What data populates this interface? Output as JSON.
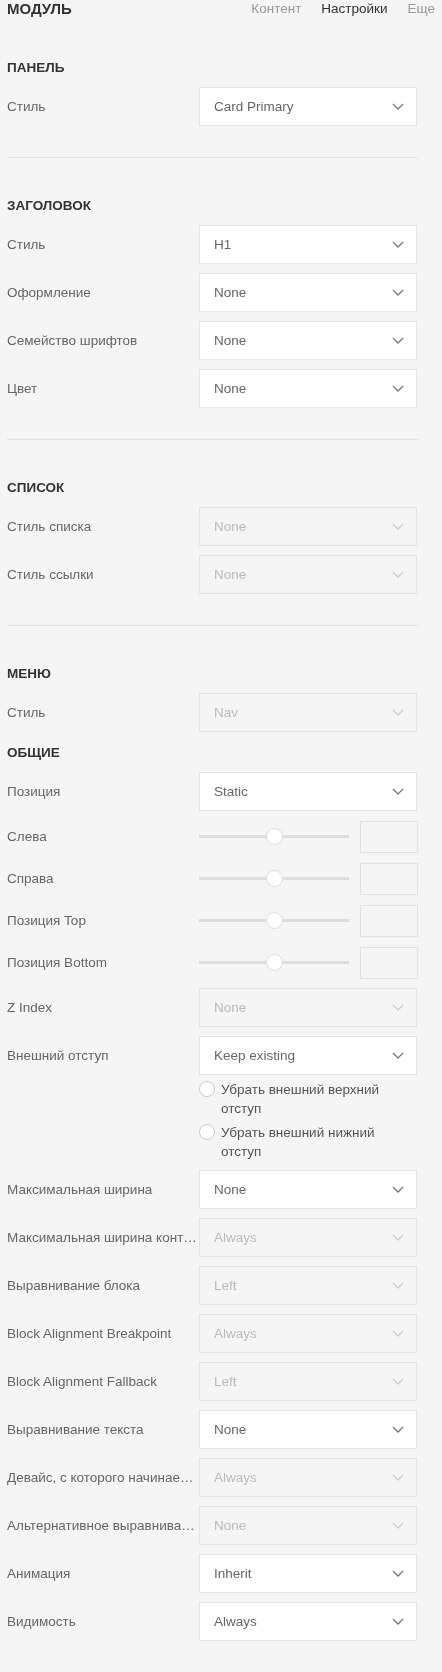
{
  "header": {
    "title": "МОДУЛЬ",
    "tabs": [
      {
        "label": "Контент",
        "selected": false
      },
      {
        "label": "Настройки",
        "selected": true
      },
      {
        "label": "Еще",
        "selected": false
      }
    ]
  },
  "sections": [
    {
      "title": "ПАНЕЛЬ",
      "divider": true,
      "fields": [
        {
          "kind": "select",
          "label": "Стиль",
          "value": "Card Primary",
          "disabled": false
        }
      ]
    },
    {
      "title": "ЗАГОЛОВОК",
      "divider": true,
      "fields": [
        {
          "kind": "select",
          "label": "Стиль",
          "value": "H1",
          "disabled": false
        },
        {
          "kind": "select",
          "label": "Оформление",
          "value": "None",
          "disabled": false
        },
        {
          "kind": "select",
          "label": "Семейство шрифтов",
          "value": "None",
          "disabled": false
        },
        {
          "kind": "select",
          "label": "Цвет",
          "value": "None",
          "disabled": false
        }
      ]
    },
    {
      "title": "СПИСОК",
      "divider": true,
      "fields": [
        {
          "kind": "select",
          "label": "Стиль списка",
          "value": "None",
          "disabled": true
        },
        {
          "kind": "select",
          "label": "Стиль ссылки",
          "value": "None",
          "disabled": true
        }
      ]
    },
    {
      "title": "МЕНЮ",
      "divider": false,
      "fields": [
        {
          "kind": "select",
          "label": "Стиль",
          "value": "Nav",
          "disabled": true
        }
      ]
    },
    {
      "title": "ОБЩИЕ",
      "divider": false,
      "fields": [
        {
          "kind": "select",
          "label": "Позиция",
          "value": "Static",
          "disabled": false
        },
        {
          "kind": "slider",
          "label": "Слева",
          "level": 0.5
        },
        {
          "kind": "slider",
          "label": "Справа",
          "level": 0.5
        },
        {
          "kind": "slider",
          "label": "Позиция Top",
          "level": 0.5
        },
        {
          "kind": "slider",
          "label": "Позиция Bottom",
          "level": 0.5
        },
        {
          "kind": "select",
          "label": "Z Index",
          "value": "None",
          "disabled": true
        },
        {
          "kind": "select",
          "label": "Внешний отступ",
          "value": "Keep existing",
          "disabled": false
        },
        {
          "kind": "checkbox",
          "label": "Убрать внешний верхний отступ",
          "checked": false
        },
        {
          "kind": "checkbox",
          "label": "Убрать внешний нижний отступ",
          "checked": false
        },
        {
          "kind": "select",
          "label": "Максимальная ширина",
          "value": "None",
          "disabled": false
        },
        {
          "kind": "select",
          "label": "Максимальная ширина конт…",
          "value": "Always",
          "disabled": true
        },
        {
          "kind": "select",
          "label": "Выравнивание блока",
          "value": "Left",
          "disabled": true
        },
        {
          "kind": "select",
          "label": "Block Alignment Breakpoint",
          "value": "Always",
          "disabled": true
        },
        {
          "kind": "select",
          "label": "Block Alignment Fallback",
          "value": "Left",
          "disabled": true
        },
        {
          "kind": "select",
          "label": "Выравнивание текста",
          "value": "None",
          "disabled": false
        },
        {
          "kind": "select",
          "label": "Девайс, с которого начинае…",
          "value": "Always",
          "disabled": true
        },
        {
          "kind": "select",
          "label": "Альтернативное выравнива…",
          "value": "None",
          "disabled": true
        },
        {
          "kind": "select",
          "label": "Анимация",
          "value": "Inherit",
          "disabled": false
        },
        {
          "kind": "select",
          "label": "Видимость",
          "value": "Always",
          "disabled": false
        }
      ]
    }
  ]
}
